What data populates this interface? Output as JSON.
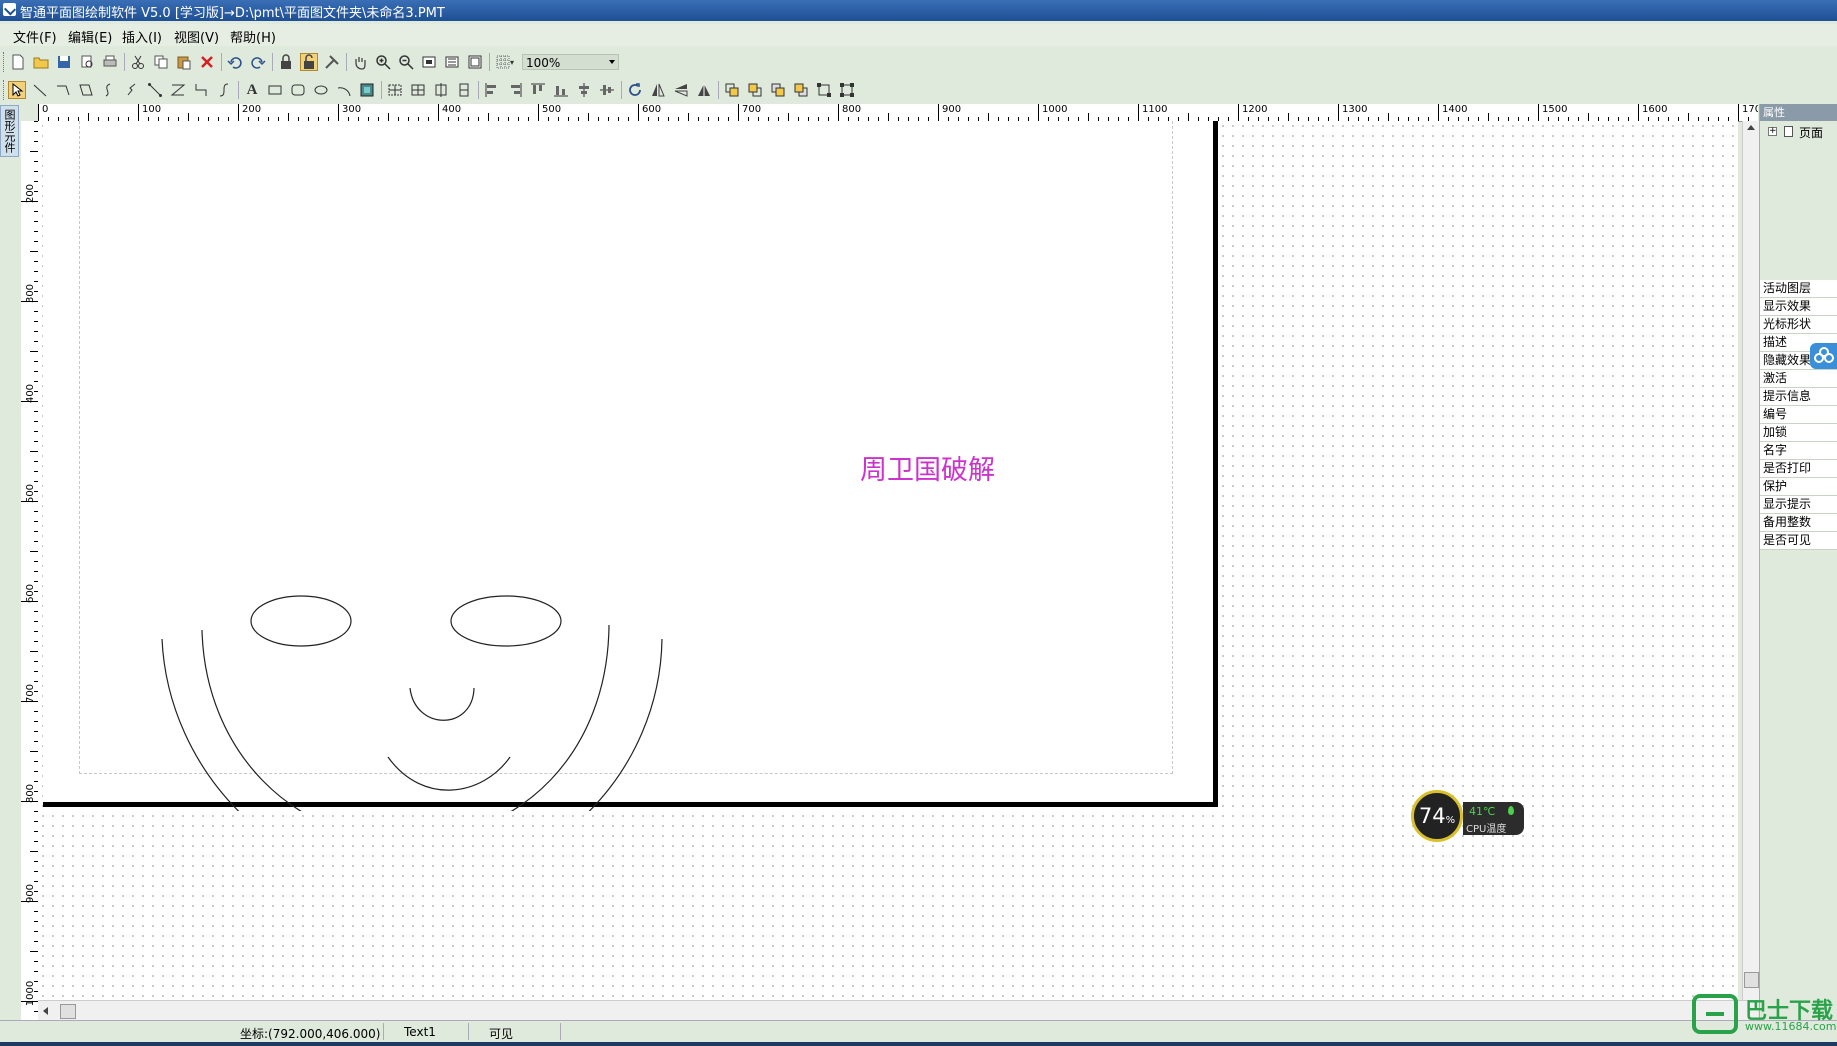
{
  "window": {
    "title": "智通平面图绘制软件 V5.0 [学习版]→D:\\pmt\\平面图文件夹\\未命名3.PMT"
  },
  "menu": [
    "文件(F)",
    "编辑(E)",
    "插入(I)",
    "视图(V)",
    "帮助(H)"
  ],
  "toolbar": {
    "zoom_value": "100%"
  },
  "left_tab": "图形元件",
  "ruler": {
    "h_labels": [
      "0",
      "100",
      "200",
      "300",
      "400",
      "500",
      "600",
      "700",
      "800",
      "900",
      "1000",
      "1100",
      "1200",
      "1300",
      "1400",
      "1500",
      "1600",
      "170"
    ],
    "v_labels": [
      "200",
      "300",
      "400",
      "500",
      "600",
      "700",
      "800",
      "900",
      "1000"
    ]
  },
  "canvas": {
    "text_label": "周卫国破解"
  },
  "properties": {
    "header": "属性",
    "tree_root": "页面",
    "rows": [
      "活动图层",
      "显示效果",
      "光标形状",
      "描述",
      "隐藏效果",
      "激活",
      "提示信息",
      "编号",
      "加锁",
      "名字",
      "是否打印",
      "保护",
      "显示提示",
      "备用整数",
      "是否可见"
    ]
  },
  "status": {
    "coords": "坐标:(792.000,406.000)",
    "object": "Text1",
    "visibility": "可见"
  },
  "cpu_widget": {
    "percent": "74",
    "percent_unit": "%",
    "temp": "41℃",
    "label": "CPU温度"
  },
  "logo": {
    "text": "巴士下载",
    "url": "www.11684.com"
  }
}
